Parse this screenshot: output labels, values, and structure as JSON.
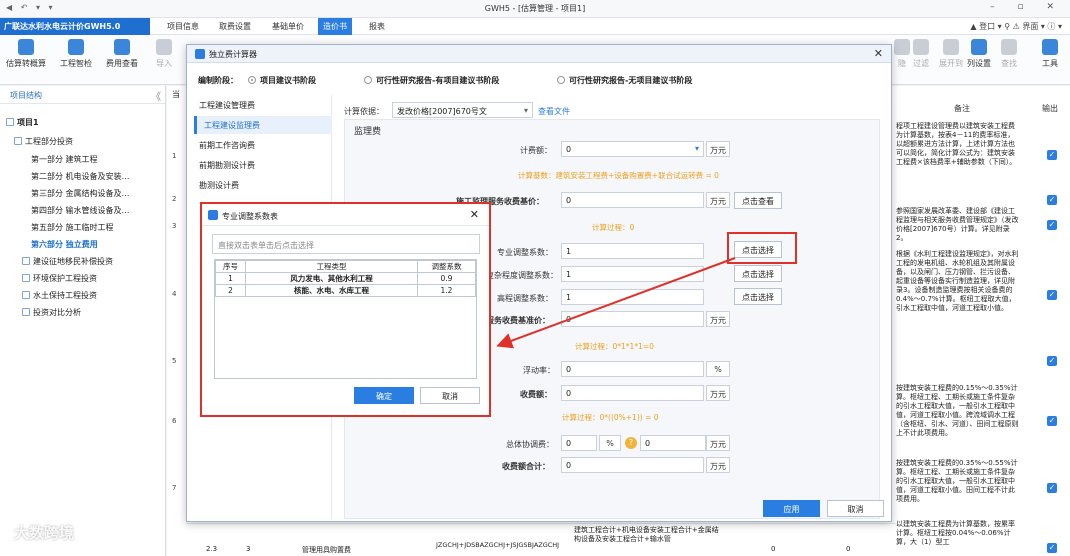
{
  "window": {
    "title": "GWH5 - [估算管理 - 项目1]",
    "quick": "◀ ↶ ▾ ▾",
    "controls": "– ▫ ✕"
  },
  "menubar": {
    "brand": "广联达水利水电云计价GWH5.0",
    "items": [
      "项目信息",
      "取费设置",
      "基础单价",
      "造价书",
      "报表"
    ],
    "right": "▲ 登口 ▾ ⚲ ⚠ 界面 ▾ ⓘ ▾"
  },
  "toolbar": {
    "left": [
      "估算转概算",
      "工程智检",
      "费用查看",
      "导入"
    ],
    "right": [
      "隐",
      "过滤",
      "展开到",
      "列设置",
      "查找",
      "工具"
    ]
  },
  "leftpanel": {
    "header": "项目结构",
    "collapse": "《",
    "tree": [
      "项目1",
      "工程部分投资",
      "第一部分  建筑工程",
      "第二部分  机电设备及安装…",
      "第三部分  金属结构设备及…",
      "第四部分  输水管线设备及…",
      "第五部分  施工临时工程",
      "第六部分  独立费用",
      "建设征地移民补偿投资",
      "环境保护工程投资",
      "水土保持工程投资",
      "投资对比分析"
    ]
  },
  "grid": {
    "headers": {
      "left": "当",
      "remark": "备注",
      "output": "输出"
    },
    "rownums": [
      "1",
      "2",
      "3",
      "4",
      "5",
      "6",
      "7"
    ],
    "notes": [
      "程项工程建设管理费以建筑安装工程费为计算基数，按表4－11的费率标准，以超额累进方法计算，上述计算方法也可以简化，简化计算公式为：建筑安装工程费×该档费率+辅助参数（下同）。",
      "参照国家发展改革委、建设部《建设工程监理与相关服务收费管理规定》（发改价格[2007]670号）计算。详见附录2。",
      "根据《水利工程建设监理规定》，对水利工程的发电机组、水轮机组及其附属设备，以及闸门、压力钢管、拦污设备、起重设备等设备实行制造监理，详见附录3。设备制造监理费按相关设备费的0.4%～0.7%计算。枢纽工程取大值，引水工程取中值，河道工程取小值。",
      "按建筑安装工程费的0.15%～0.35%计算。枢纽工程、工期长或施工条件复杂的引水工程取大值，一般引水工程取中值，河道工程取小值。跨流域调水工程（含枢纽、引水、河道）、田间工程原则上不计此项费用。",
      "按建筑安装工程费的0.35%～0.55%计算。枢纽工程、工期长或施工条件复杂的引水工程取大值，一般引水工程取中值，河道工程取小值。田间工程不计此项费用。",
      "以建筑安装工程费为计算基数，按累率计算。枢纽工程按0.04%～0.06%计算，大（1）型工"
    ],
    "bottom_cells": [
      "2.3",
      "3",
      "管理用具购置费",
      "JZGCHJ+JDSBAZGCHJ+JSJGSBJAZGCHJ",
      "建筑工程合计+机电设备安装工程合计+金属结构设备及安装工程合计+输水管",
      "0",
      "0"
    ]
  },
  "dialog": {
    "title": "独立费计算器",
    "close": "✕",
    "stage_label": "编制阶段：",
    "stages": [
      "项目建议书阶段",
      "可行性研究报告-有项目建议书阶段",
      "可行性研究报告-无项目建议书阶段"
    ],
    "nav": [
      "工程建设管理费",
      "工程建设监理费",
      "前期工作咨询费",
      "前期勘测设计费",
      "勘测设计费"
    ],
    "calc_basis_label": "计算依据：",
    "calc_basis_value": "发改价格[2007]670号文",
    "view_file": "查看文件",
    "section": "监理费",
    "fee_amount_label": "计费额：",
    "fee_amount_value": "0",
    "calc_base_text": "计算基数：建筑安装工程费+设备购置费+联合试运转费 = 0",
    "service_base_label": "施工监理服务收费基价：",
    "service_base_value": "0",
    "calc_process1": "计算过程：0",
    "pro_adj_label": "专业调整系数：",
    "pro_adj_value": "1",
    "complex_adj_label": "复杂程度调整系数：",
    "complex_adj_value": "1",
    "alt_adj_label": "高程调整系数：",
    "alt_adj_value": "1",
    "service_charge_label": "服务收费基准价：",
    "service_charge_value": "0",
    "calc_process2": "计算过程：0*1*1*1=0",
    "float_label": "浮动率：",
    "float_value": "0",
    "charge_label": "收费额：",
    "charge_value": "0",
    "calc_process3": "计算过程：0*((0%+1)) = 0",
    "total_coord_label": "总体协调费：",
    "total_coord_value": "0",
    "total_coord_value2": "0",
    "charge_total_label": "收费额合计：",
    "charge_total_value": "0",
    "unit_wan": "万元",
    "unit_pct": "%",
    "pick_button": "点击选择",
    "view_button": "点击查看",
    "apply_button": "应用",
    "cancel_button": "取消",
    "help_icon": "?"
  },
  "subdialog": {
    "title": "专业调整系数表",
    "close": "✕",
    "search_placeholder": "直接双击表单击后点击选择",
    "headers": [
      "序号",
      "工程类型",
      "调整系数"
    ],
    "rows": [
      [
        "1",
        "风力发电、其他水利工程",
        "0.9"
      ],
      [
        "2",
        "核能、水电、水库工程",
        "1.2"
      ]
    ],
    "ok": "确定",
    "cancel": "取消"
  },
  "watermark": "大数跨境",
  "colors": {
    "accent": "#2a7de1",
    "highlight": "#e0302a",
    "orange_text": "#f0a020"
  }
}
